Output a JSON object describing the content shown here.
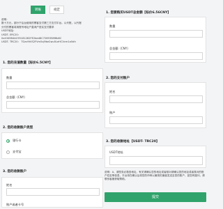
{
  "tabs": [
    {
      "label": "转账",
      "active": true
    },
    {
      "label": "规定",
      "active": false
    }
  ],
  "intro": {
    "lines": [
      "说明：",
      "数十万元，部分于后台使用的黑客支付第三方支付平台。以代账，以代账",
      "分付的黑客将用账号地址户直询户查实支付要求",
      "",
      "USDT地址：",
      "USDT- ERC20：",
      "0x4345B4AC95181282FE2bed6C7269358f6b6C",
      "USDT- TRC20： TGzv9tVS2FVm5xJ9be2wu5LeHCVcm1a5dh"
    ]
  },
  "left": {
    "section1": {
      "title": "1. 您的充值数量【标价6.5CNY】",
      "qty_label": "数量",
      "total_label": "总金额（CNY）"
    },
    "section2": {
      "title": "2. 您的收款账户类型",
      "options": [
        {
          "label": "银行卡",
          "checked": true
        },
        {
          "label": "支付宝",
          "checked": false
        }
      ]
    },
    "section3": {
      "title": "3. 您的收款账户",
      "name_label": "姓名",
      "account_label": "账户或者卡号"
    }
  },
  "right": {
    "section1": {
      "title": "1. 您要购买USDT总金额【标价6.56CNY】",
      "qty_label": "数量",
      "total_label": "总金额（CNY）"
    },
    "section2": {
      "title": "2. 您的支付账户",
      "name_label": "姓名",
      "account_label": "账户"
    },
    "section3": {
      "title": "3. 您的收款地址【USDT- TRC20】",
      "address_label": "USDT地址"
    }
  },
  "note": "说明：A、请您务必核查地址、有关请确认您的地址或者核对请确认您的地址或者核对的账户姓名等信息，平台将在确认后将您的币种以最快的速度发送至您的账户，如您有疑问，请联系客服获取帮助。",
  "submit_label": "提交"
}
